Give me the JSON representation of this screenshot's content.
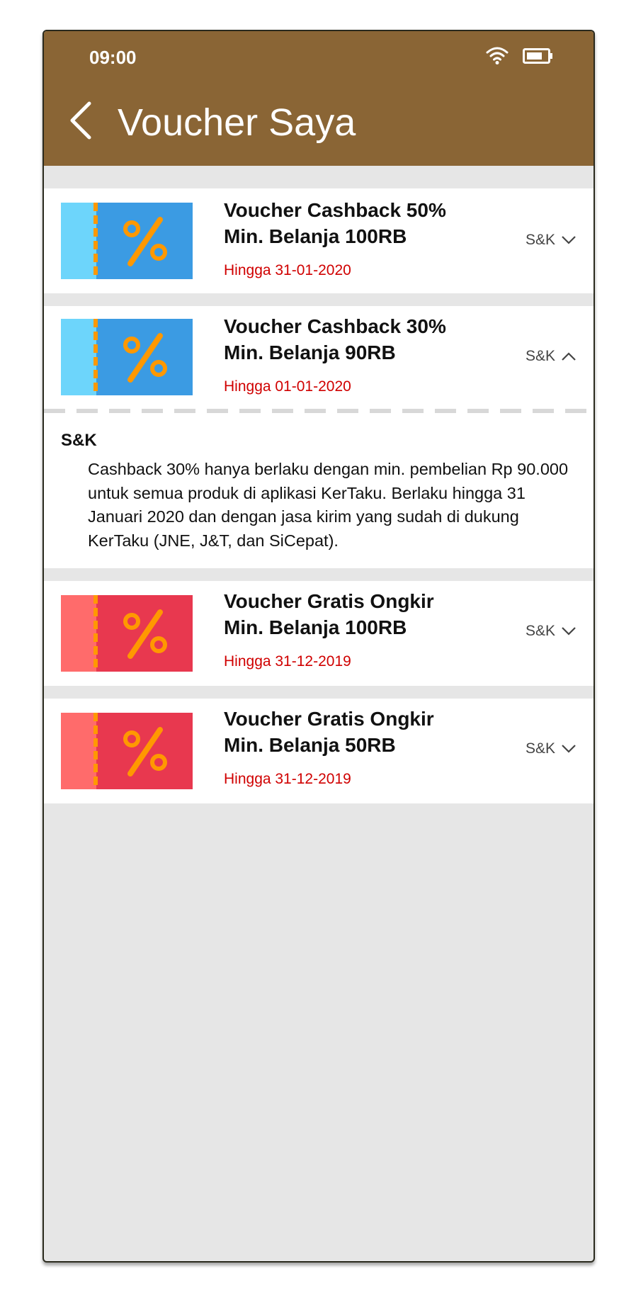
{
  "status_bar": {
    "time": "09:00"
  },
  "header": {
    "title": "Voucher Saya"
  },
  "vouchers": [
    {
      "title_line1": "Voucher Cashback 50%",
      "title_line2": "Min. Belanja 100RB",
      "expiry": "Hingga 31-01-2020",
      "terms_label": "S&K",
      "expanded": false,
      "ticket_style": "blue"
    },
    {
      "title_line1": "Voucher Cashback 30%",
      "title_line2": "Min. Belanja 90RB",
      "expiry": "Hingga 01-01-2020",
      "terms_label": "S&K",
      "expanded": true,
      "ticket_style": "blue",
      "terms_heading": "S&K",
      "terms_text": "Cashback 30% hanya berlaku dengan min. pembelian Rp 90.000 untuk semua produk di aplikasi KerTaku. Berlaku hingga 31 Januari 2020 dan dengan jasa kirim yang sudah di dukung KerTaku (JNE, J&T, dan SiCepat)."
    },
    {
      "title_line1": "Voucher Gratis Ongkir",
      "title_line2": "Min. Belanja 100RB",
      "expiry": "Hingga 31-12-2019",
      "terms_label": "S&K",
      "expanded": false,
      "ticket_style": "red"
    },
    {
      "title_line1": "Voucher Gratis Ongkir",
      "title_line2": "Min. Belanja 50RB",
      "expiry": "Hingga 31-12-2019",
      "terms_label": "S&K",
      "expanded": false,
      "ticket_style": "red"
    }
  ],
  "colors": {
    "header_bg": "#8a6535",
    "page_bg": "#e6e6e6",
    "expiry_text": "#d00000",
    "ticket_blue_stub": "#6dd5fb",
    "ticket_blue_body": "#3b9be3",
    "ticket_red_stub": "#ff6b6b",
    "ticket_red_body": "#e8384f",
    "ticket_percent": "#ff9800"
  }
}
